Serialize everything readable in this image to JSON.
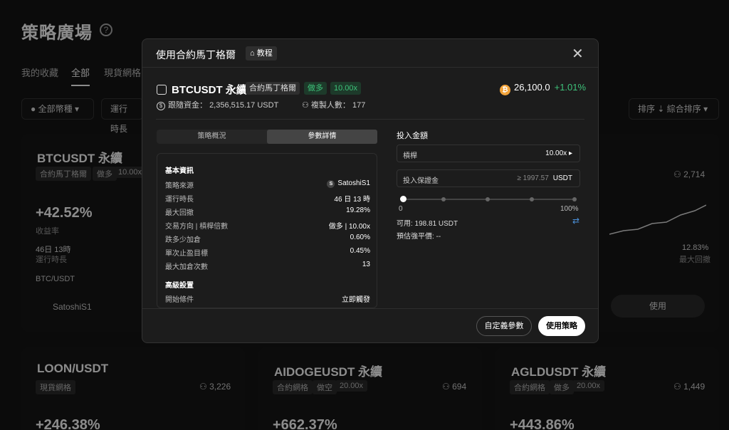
{
  "page": {
    "title": "策略廣場",
    "tabs": [
      "我的收藏",
      "全部",
      "現貨網格"
    ],
    "filter_coin": "全部幣種",
    "filter_runtime": "運行時長",
    "sort_label": "排序",
    "sort_value": "綜合排序"
  },
  "cards": [
    {
      "symbol": "BTCUSDT 永續",
      "tag1": "合約馬丁格爾",
      "tag2": "做多",
      "tag3": "10.00x",
      "roi": "+42.52%",
      "roi_label": "收益率",
      "runtime": "46日 13時",
      "runtime_label": "運行時長",
      "pair": "BTC/USDT",
      "author": "SatoshiS1"
    },
    {
      "followers": "2,714",
      "drawdown": "12.83%",
      "drawdown_label": "最大回撤",
      "use_label": "使用"
    },
    {
      "symbol": "LOON/USDT",
      "tag1": "現貨網格",
      "followers": "3,226",
      "roi": "+246.38%"
    },
    {
      "symbol": "AIDOGEUSDT 永續",
      "tag1": "合約網格",
      "tag2": "做空",
      "tag3": "20.00x",
      "followers": "694",
      "roi": "+662.37%"
    },
    {
      "symbol": "AGLDUSDT 永續",
      "tag1": "合約網格",
      "tag2": "做多",
      "tag3": "20.00x",
      "followers": "1,449",
      "roi": "+443.86%"
    }
  ],
  "modal": {
    "title": "使用合約馬丁格爾",
    "tutorial": "教程",
    "symbol": "BTCUSDT 永續",
    "tag_type": "合約馬丁格爾",
    "tag_dir": "做多",
    "tag_lev": "10.00x",
    "price": "26,100.0",
    "change": "+1.01%",
    "follow_label": "跟隨資金：",
    "follow_value": "2,356,515.17 USDT",
    "copies_label": "複製人數：",
    "copies_value": "177",
    "seg_tabs": [
      "策略概況",
      "參數詳情"
    ],
    "basic_title": "基本資訊",
    "basic": [
      {
        "k": "策略來源",
        "v": "SatoshiS1"
      },
      {
        "k": "運行時長",
        "v": "46 日 13 時"
      },
      {
        "k": "最大回撤",
        "v": "19.28%"
      },
      {
        "k": "交易方向 | 槓桿倍數",
        "v": "做多 | 10.00x"
      },
      {
        "k": "跌多少加倉",
        "v": "0.60%"
      },
      {
        "k": "單次止盈目標",
        "v": "0.45%"
      },
      {
        "k": "最大加倉次數",
        "v": "13"
      }
    ],
    "adv_title": "高級設置",
    "adv": [
      {
        "k": "開始條件",
        "v": "立即觸發"
      }
    ],
    "invest_title": "投入金額",
    "leverage_label": "槓桿",
    "leverage_value": "10.00x",
    "margin_label": "投入保證金",
    "margin_hint": "≥ 1997.57",
    "margin_unit": "USDT",
    "slider_min": "0",
    "slider_max": "100%",
    "slider_value": 0,
    "available": "可用: 198.81 USDT",
    "liq_label": "預估強平價: --",
    "custom_btn": "自定義參數",
    "use_btn": "使用策略"
  }
}
